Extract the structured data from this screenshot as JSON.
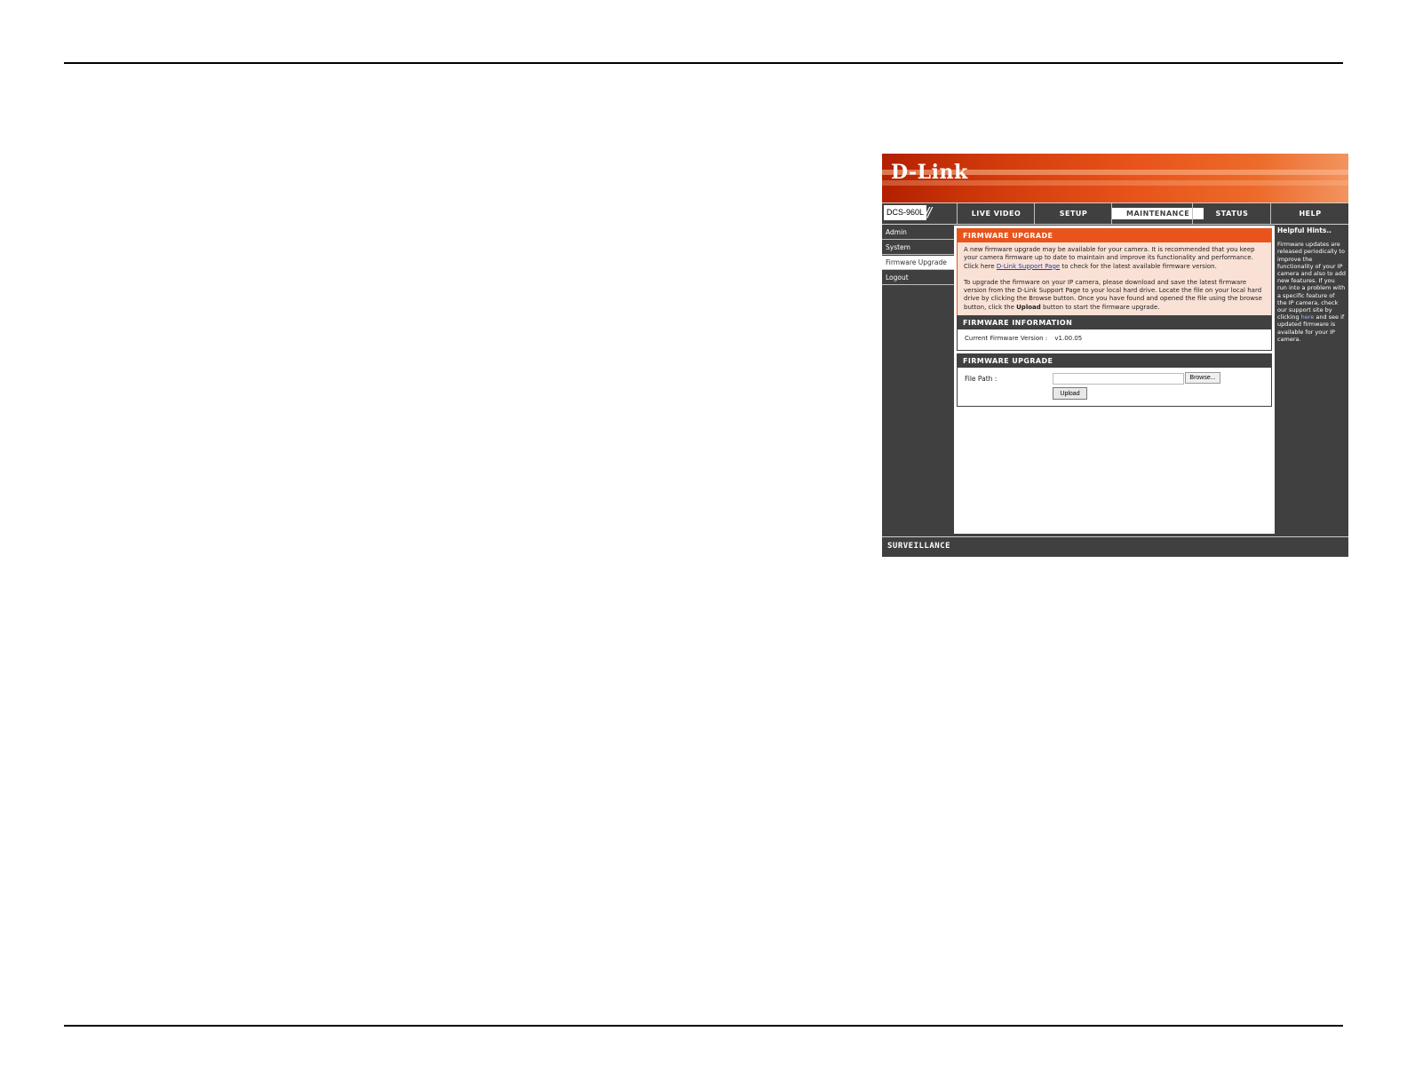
{
  "camera_ui": {
    "logo": "D-Link",
    "model": "DCS-960L",
    "tabs": [
      "LIVE VIDEO",
      "SETUP",
      "MAINTENANCE",
      "STATUS",
      "HELP"
    ],
    "active_tab": "MAINTENANCE",
    "sidebar": {
      "items": [
        "Admin",
        "System",
        "Firmware Upgrade",
        "Logout"
      ],
      "active": "Firmware Upgrade"
    },
    "intro": {
      "title": "FIRMWARE UPGRADE",
      "p1_text": "A new firmware upgrade may be available for your camera. It is recommended that you keep your camera firmware up to date to maintain and improve its functionality and performance. Click here ",
      "p1_link": "D-Link Support Page",
      "p1_tail": " to check for the latest available firmware version.",
      "p2_text": "To upgrade the firmware on your IP camera, please download and save the latest firmware version from the D-Link Support Page to your local hard drive. Locate the file on your local hard drive by clicking the Browse button. Once you have found and opened the file using the browse button, click the ",
      "p2_bold": "Upload",
      "p2_tail": " button to start the firmware upgrade."
    },
    "firmware_info": {
      "title": "FIRMWARE INFORMATION",
      "label": "Current Firmware Version :",
      "value": "v1.00.05"
    },
    "upgrade": {
      "title": "FIRMWARE UPGRADE",
      "file_path_label": "File Path :",
      "file_path_value": "",
      "browse_label": "Browse...",
      "upload_label": "Upload"
    },
    "hints": {
      "title": "Helpful Hints..",
      "text_before": "Firmware updates are released periodically to improve the functionality of your IP camera and also to add new features. If you run into a problem with a specific feature of the IP camera, check our support site by clicking ",
      "link": "here",
      "text_after": " and see if updated firmware is available for your IP camera."
    },
    "footer": "SURVEILLANCE"
  }
}
